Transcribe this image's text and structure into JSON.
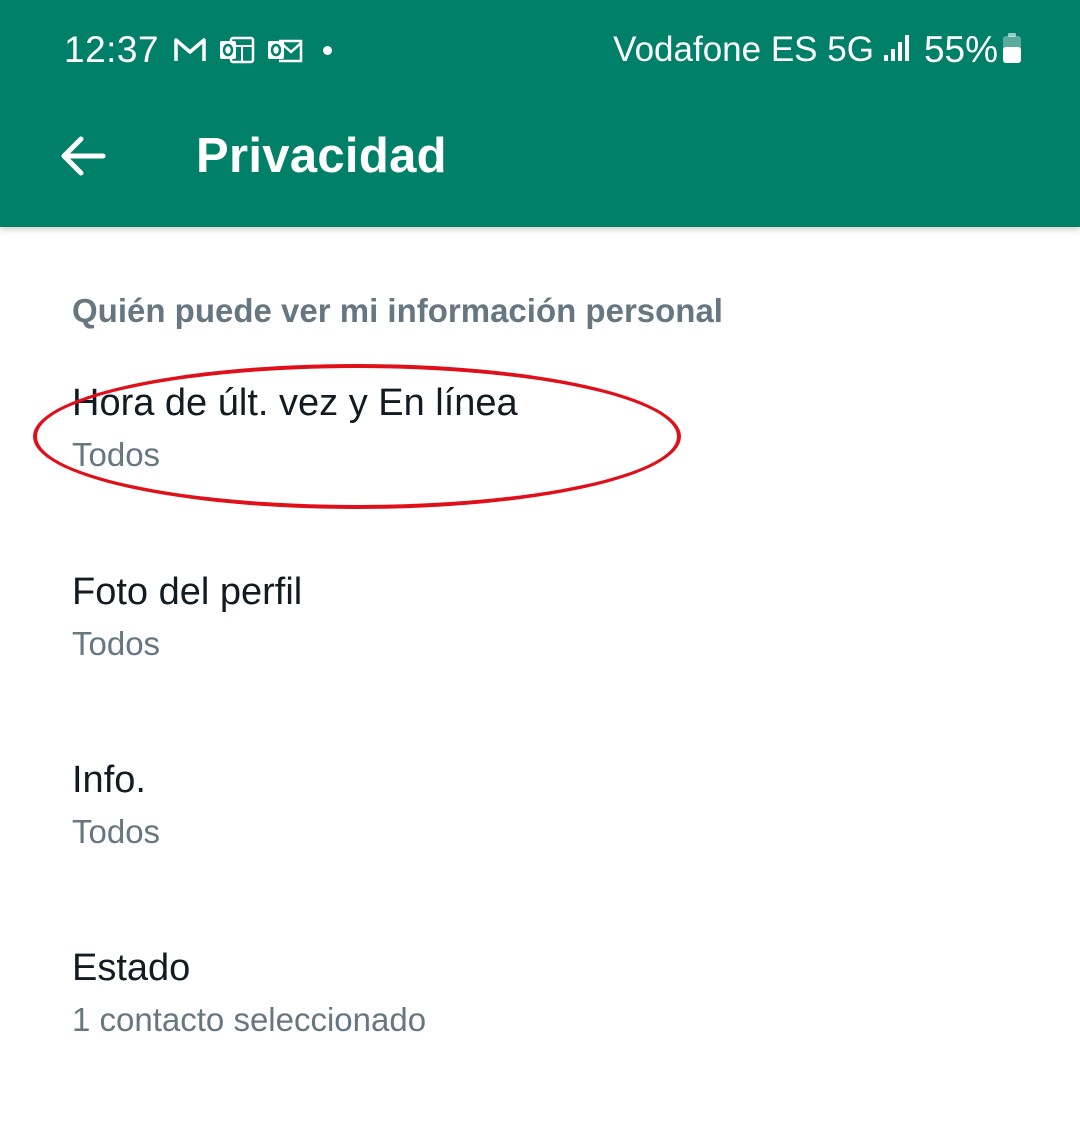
{
  "colors": {
    "header_bg": "#008069",
    "header_text": "#ffffff",
    "section_header_text": "#667781",
    "item_title_text": "#111b21",
    "item_subtitle_text": "#667781",
    "highlight_ring": "#e0101a"
  },
  "status_bar": {
    "time": "12:37",
    "notification_icons": [
      "gmail-icon",
      "outlook-calendar-icon",
      "outlook-mail-icon",
      "more-notifications-dot"
    ],
    "carrier": "Vodafone ES 5G",
    "signal_icon": "signal-bars-icon",
    "battery_percent": "55%",
    "battery_icon": "battery-icon"
  },
  "toolbar": {
    "back_icon": "arrow-left-icon",
    "title": "Privacidad"
  },
  "section": {
    "header": "Quién puede ver mi información personal"
  },
  "settings": [
    {
      "title": "Hora de últ. vez y En línea",
      "value": "Todos",
      "highlighted": true
    },
    {
      "title": "Foto del perfil",
      "value": "Todos",
      "highlighted": false
    },
    {
      "title": "Info.",
      "value": "Todos",
      "highlighted": false
    },
    {
      "title": "Estado",
      "value": "1 contacto seleccionado",
      "highlighted": false
    }
  ]
}
